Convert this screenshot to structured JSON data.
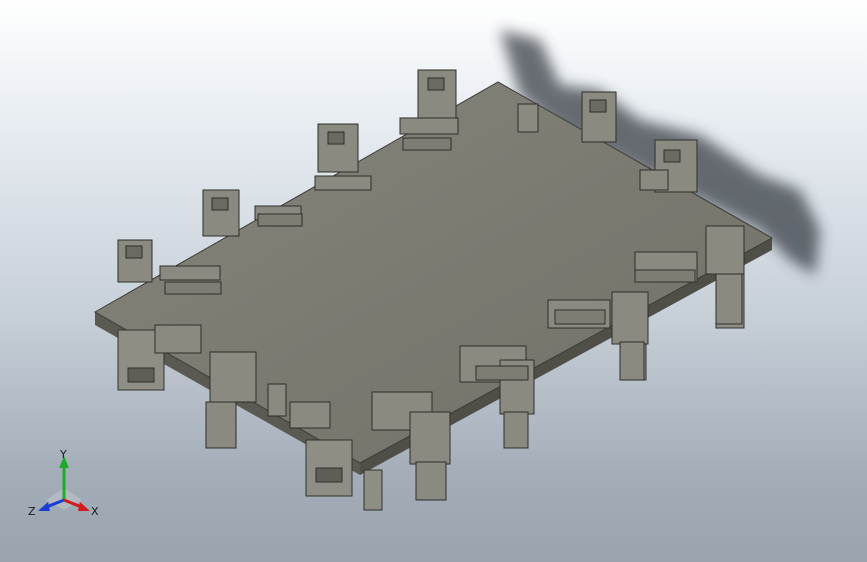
{
  "viewport": {
    "background_top": "#ffffff",
    "background_bottom": "#9aa4af"
  },
  "model": {
    "plate_top_color": "#7a7a70",
    "plate_edge_color": "#5e5e56",
    "fixture_color": "#8c8c82",
    "shadow_color": "#3a3f46"
  },
  "triad": {
    "x_label": "X",
    "y_label": "Y",
    "z_label": "Z",
    "x_color": "#d11c1c",
    "y_color": "#1faa2b",
    "z_color": "#1a3fd6"
  }
}
